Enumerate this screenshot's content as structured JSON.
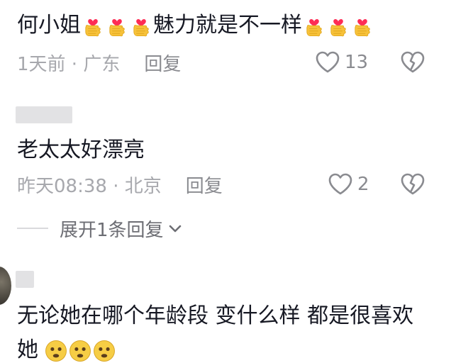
{
  "comment1": {
    "name_part": "何小姐",
    "middle_text": "魅力就是不一样",
    "emoji_name": "heart-hands-emoji",
    "time": "1天前 · 广东",
    "reply_label": "回复",
    "like_count": "13"
  },
  "comment2": {
    "text": "老太太好漂亮",
    "time": "昨天08:38 · 北京",
    "reply_label": "回复",
    "like_count": "2",
    "expand_label": "展开1条回复"
  },
  "comment3": {
    "text": "无论她在哪个年龄段 变什么样 都是很喜欢",
    "text_line2": "她",
    "emoji_name": "teary-emoji"
  },
  "colors": {
    "text": "#161823",
    "meta": "#9a9ba0",
    "icon": "#8a8b90",
    "emoji_heart": "#fe2c55",
    "emoji_hand": "#f7c23a"
  },
  "icons": {
    "like": "heart-outline-icon",
    "dislike": "broken-heart-icon",
    "expand": "chevron-down-icon"
  }
}
